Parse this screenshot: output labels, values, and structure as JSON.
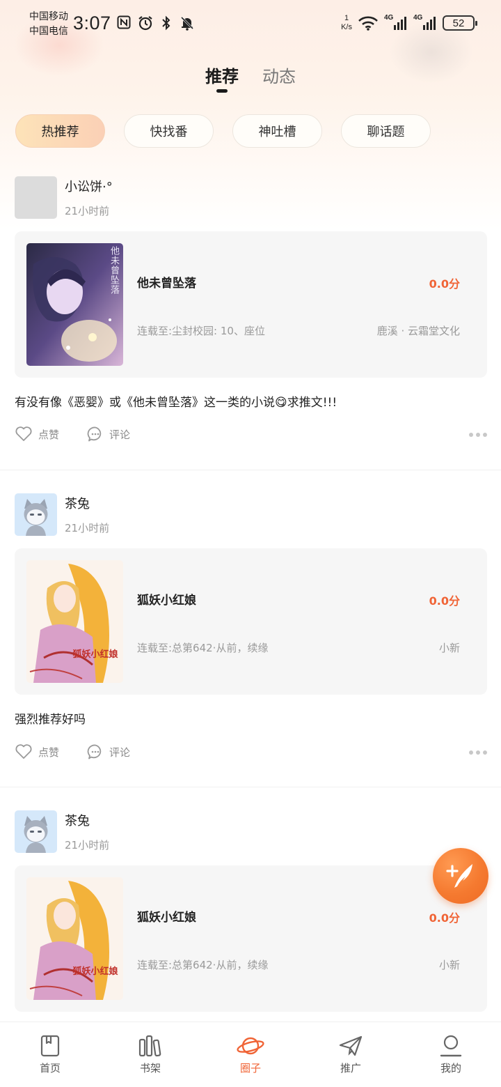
{
  "status_bar": {
    "carrier_1": "中国移动",
    "carrier_2": "中国电信",
    "time": "3:07",
    "net_speed_value": "1",
    "net_speed_unit": "K/s",
    "signal_1": "4G",
    "signal_2": "4G",
    "battery": "52"
  },
  "top_tabs": [
    {
      "label": "推荐",
      "active": true
    },
    {
      "label": "动态",
      "active": false
    }
  ],
  "chips": [
    {
      "label": "热推荐",
      "active": true
    },
    {
      "label": "快找番",
      "active": false
    },
    {
      "label": "神吐槽",
      "active": false
    },
    {
      "label": "聊话题",
      "active": false
    }
  ],
  "posts": [
    {
      "username": "小讼饼·°",
      "time": "21小时前",
      "book": {
        "title": "他未曾坠落",
        "score": "0.0分",
        "chapter": "连载至:尘封校园: 10、座位",
        "author": "鹿溪 · 云霜堂文化",
        "cover_text": "他未曾坠落"
      },
      "text": "有没有像《恶婴》或《他未曾坠落》这一类的小说😋求推文!!!",
      "like_label": "点赞",
      "comment_label": "评论"
    },
    {
      "username": "茶兔",
      "time": "21小时前",
      "book": {
        "title": "狐妖小红娘",
        "score": "0.0分",
        "chapter": "连载至:总第642·从前，续缘",
        "author": "小新",
        "cover_text": "狐妖小红娘"
      },
      "text": "强烈推荐好吗",
      "like_label": "点赞",
      "comment_label": "评论"
    },
    {
      "username": "茶兔",
      "time": "21小时前",
      "book": {
        "title": "狐妖小红娘",
        "score": "0.0分",
        "chapter": "连载至:总第642·从前，续缘",
        "author": "小新",
        "cover_text": "狐妖小红娘"
      }
    }
  ],
  "bottom_nav": [
    {
      "label": "首页",
      "icon": "book-icon",
      "active": false
    },
    {
      "label": "书架",
      "icon": "bookshelf-icon",
      "active": false
    },
    {
      "label": "圈子",
      "icon": "planet-icon",
      "active": true
    },
    {
      "label": "推广",
      "icon": "paper-plane-icon",
      "active": false
    },
    {
      "label": "我的",
      "icon": "user-icon",
      "active": false
    }
  ],
  "colors": {
    "accent": "#f06436",
    "chip_active_start": "#fde3b8",
    "chip_active_end": "#fbd0b6",
    "fab": "#f57a30"
  }
}
